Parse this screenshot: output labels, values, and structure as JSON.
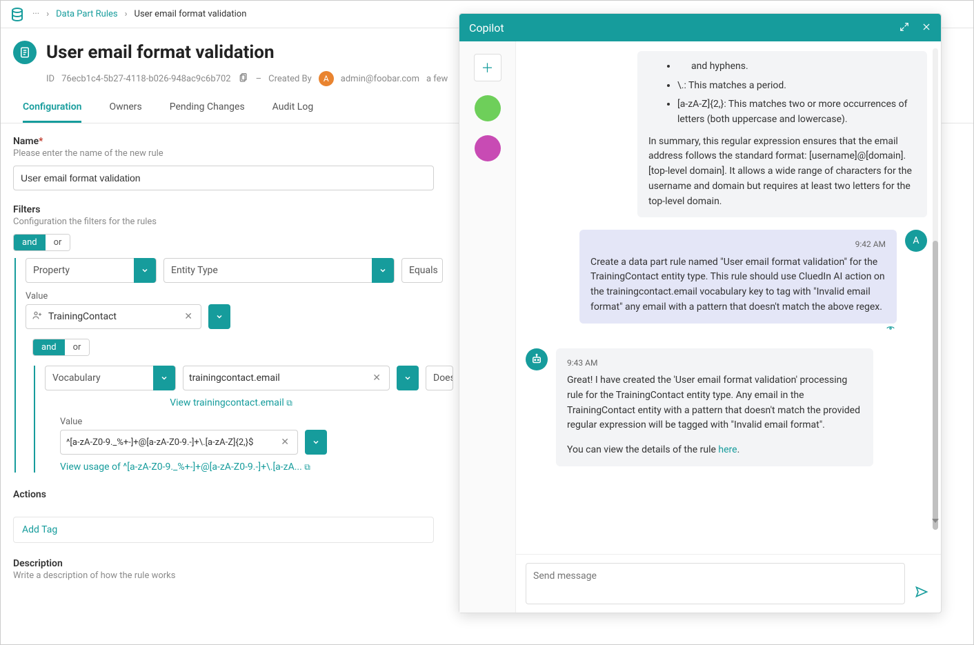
{
  "breadcrumb": {
    "ellipsis": "···",
    "parent": "Data Part Rules",
    "current": "User email format validation"
  },
  "header": {
    "title": "User email format validation",
    "id_label": "ID",
    "id_value": "76ecb1c4-5b27-4118-b026-948ac9c6b702",
    "created_by_label": "Created By",
    "created_by_initial": "A",
    "created_by_email": "admin@foobar.com",
    "created_when": "a few"
  },
  "tabs": {
    "configuration": "Configuration",
    "owners": "Owners",
    "pending": "Pending Changes",
    "audit": "Audit Log"
  },
  "form": {
    "name_label": "Name",
    "name_help": "Please enter the name of the new rule",
    "name_value": "User email format validation",
    "filters_label": "Filters",
    "filters_help": "Configuration the filters for the rules",
    "and": "and",
    "or": "or",
    "property": "Property",
    "entity_type": "Entity Type",
    "equals_op": "Equals",
    "value_label": "Value",
    "value_training": "TrainingContact",
    "vocabulary": "Vocabulary",
    "vocab_value": "trainingcontact.email",
    "does_op": "Does",
    "view_vocab": "View trainingcontact.email",
    "regex_value": "^[a-zA-Z0-9._%+-]+@[a-zA-Z0-9.-]+\\.[a-zA-Z]{2,}$",
    "view_regex": "View usage of ^[a-zA-Z0-9._%+-]+@[a-zA-Z0-9.-]+\\.[a-zA...",
    "actions_label": "Actions",
    "add_tag": "Add Tag",
    "description_label": "Description",
    "description_help": "Write a description of how the rule works"
  },
  "copilot": {
    "title": "Copilot",
    "bullet1": "and hyphens.",
    "bullet2": "\\.: This matches a period.",
    "bullet3": "[a-zA-Z]{2,}: This matches two or more occurrences of letters (both uppercase and lowercase).",
    "summary": "In summary, this regular expression ensures that the email address follows the standard format: [username]@[domain].[top-level domain]. It allows a wide range of characters for the username and domain but requires at least two letters for the top-level domain.",
    "user_time": "9:42 AM",
    "user_msg": "Create a data part rule named \"User email format validation\" for the TrainingContact entity type. This rule should use CluedIn AI action on the trainingcontact.email vocabulary key to tag with \"Invalid email format\" any email with a pattern that doesn't match the above regex.",
    "user_initial": "A",
    "bot_time": "9:43 AM",
    "bot_msg1": "Great! I have created the 'User email format validation' processing rule for the TrainingContact entity type. Any email in the TrainingContact entity with a pattern that doesn't match the provided regular expression will be tagged with \"Invalid email format\".",
    "bot_msg2_prefix": "You can view the details of the rule ",
    "bot_msg2_link": "here",
    "input_placeholder": "Send message"
  }
}
